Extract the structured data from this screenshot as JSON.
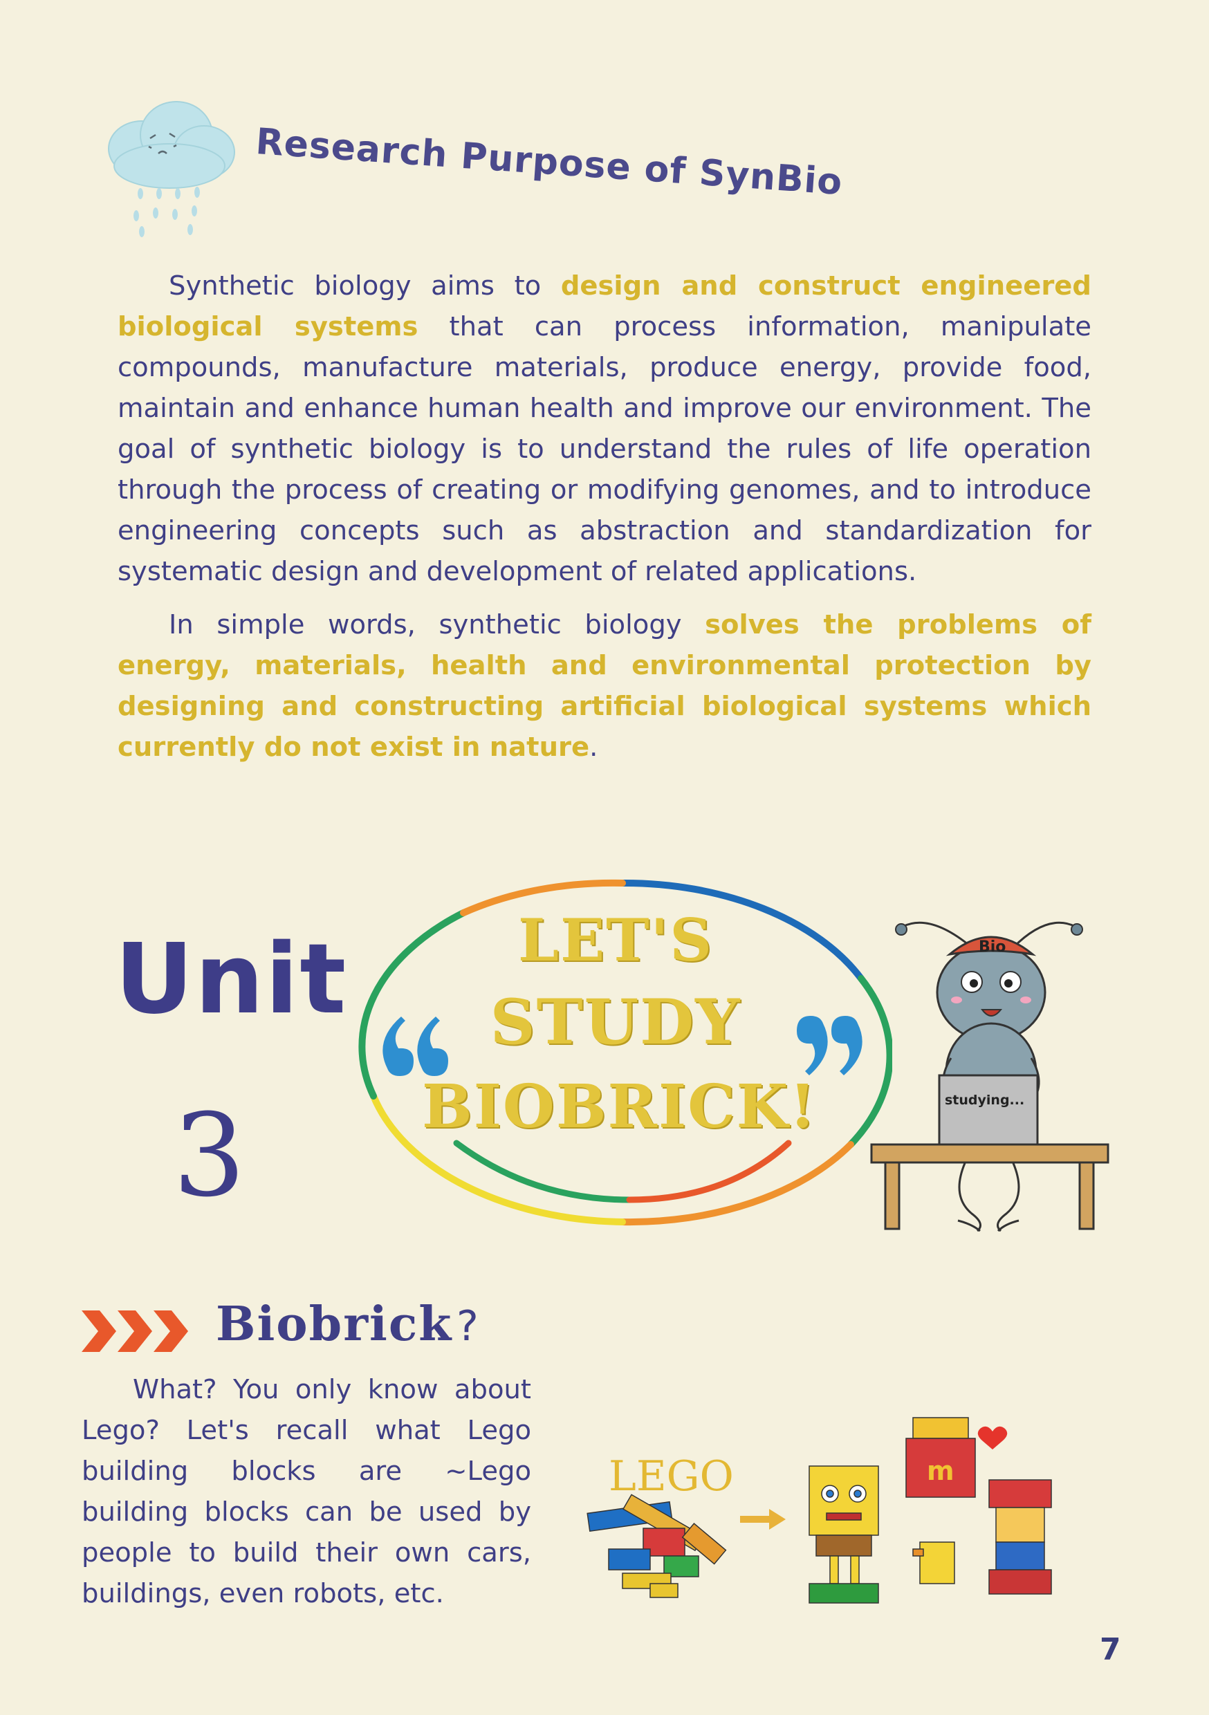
{
  "section1": {
    "title": "Research Purpose of SynBio",
    "paragraph1": {
      "part1": "Synthetic biology aims to ",
      "highlight1": "design and construct engineered biological systems",
      "part2": " that can process information, manipulate compounds, manufacture materials, produce energy, provide food, maintain and enhance human health and improve our environment. The goal of synthetic biology is to understand the rules of life operation through the process of creating or modifying genomes, and to introduce engineering concepts such as abstraction and standardization for systematic design and development of related applications."
    },
    "paragraph2": {
      "part1": "In simple words, synthetic biology ",
      "highlight1": "solves the problems of energy, materials, health and environmental protection by designing and constructing artificial biological systems which currently do not exist in nature",
      "part2": "."
    }
  },
  "unit": {
    "word": "Unit",
    "number": "3",
    "banner_line1": "LET'S",
    "banner_line2": "STUDY",
    "banner_line3": "BIOBRICK!",
    "cap_text": "Bio",
    "laptop_text": "studying..."
  },
  "biobrick": {
    "heading": "Biobrick",
    "question_mark": "?",
    "paragraph": "What? You only know about Lego? Let's recall what Lego building blocks are ~Lego building blocks can be used by people to build their own cars, buildings, even robots, etc.",
    "lego_label": "LEGO"
  },
  "page_number": "7",
  "colors": {
    "background": "#f5f1de",
    "text": "#3f3f86",
    "highlight": "#d6b52e",
    "arrow": "#e8582b"
  },
  "icons": [
    "rain-cloud-icon",
    "chevron-arrows-icon",
    "ant-mascot",
    "lego-blocks",
    "arrow-right-icon",
    "heart-icon"
  ]
}
